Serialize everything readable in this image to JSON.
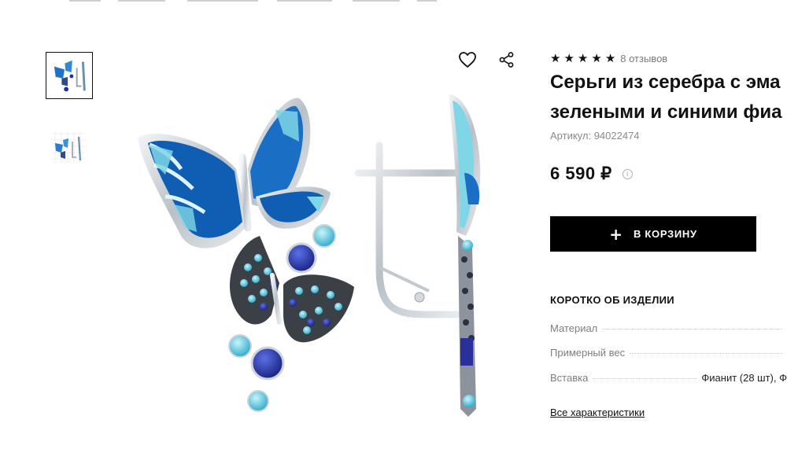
{
  "product": {
    "reviews": "8 отзывов",
    "title_line1": "Серьги из серебра с эма",
    "title_line2": "зелеными и синими фиа",
    "sku": "Артикул: 94022474",
    "price": "6 590 ₽",
    "add_to_cart": "В КОРЗИНУ",
    "stars": 5
  },
  "gallery": {
    "thumbnails": [
      {
        "name": "thumb-1",
        "active": true
      },
      {
        "name": "thumb-2",
        "active": false
      }
    ],
    "icons": [
      "heart-icon",
      "share-icon"
    ]
  },
  "specs": {
    "section_title": "КОРОТКО ОБ ИЗДЕЛИИ",
    "rows": [
      {
        "key": "Материал",
        "value": ""
      },
      {
        "key": "Примерный вес",
        "value": ""
      },
      {
        "key": "Вставка",
        "value": "Фианит (28 шт), Ф"
      }
    ],
    "all_link": "Все характеристики"
  },
  "colors": {
    "accent": "#000000",
    "enamel_dark": "#0f5eb3",
    "enamel_light": "#7fd6e6",
    "gem_blue": "#1a2fa8"
  }
}
